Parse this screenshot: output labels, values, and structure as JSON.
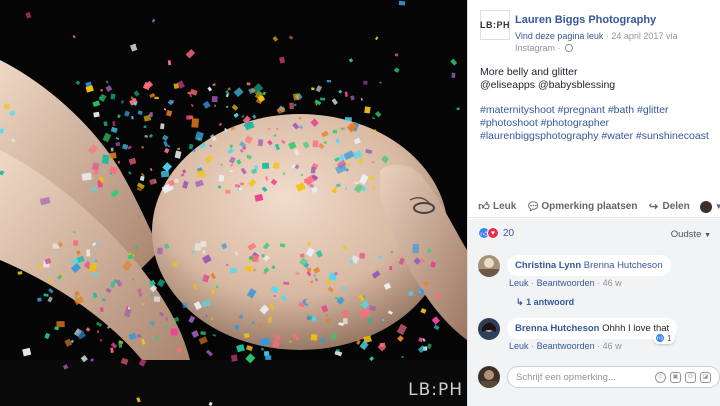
{
  "photo": {
    "watermark": "LB:PH",
    "alt": "Pregnant belly covered with colorful glitter"
  },
  "post": {
    "logo_text": "LB:PH",
    "page_name": "Lauren Biggs Photography",
    "like_page": "Vind deze pagina leuk",
    "date": "24 april 2017",
    "via": "via Instagram",
    "text_line1": "More belly and glitter",
    "text_line2": "@eliseapps @babysblessing",
    "hashtags": "#maternityshoot #pregnant #bath #glitter #photoshoot #photographer #laurenbiggsphotography #water #sunshinecoast"
  },
  "actions": {
    "like": "Leuk",
    "comment": "Opmerking plaatsen",
    "share": "Delen"
  },
  "reactions": {
    "count": "20",
    "sort": "Oudste"
  },
  "comments": [
    {
      "author": "Christina Lynn",
      "text": "Brenna Hutcheson",
      "like": "Leuk",
      "reply": "Beantwoorden",
      "time": "46 w",
      "replies": "1 antwoord"
    },
    {
      "author": "Brenna Hutcheson",
      "text": "Ohhh I love that",
      "like": "Leuk",
      "reply": "Beantwoorden",
      "time": "46 w",
      "like_count": "1"
    }
  ],
  "composer": {
    "placeholder": "Schrijf een opmerking..."
  },
  "colors": {
    "link": "#365899",
    "like_blue": "#3b82f6",
    "love_red": "#f0284a",
    "muted": "#90949c"
  }
}
